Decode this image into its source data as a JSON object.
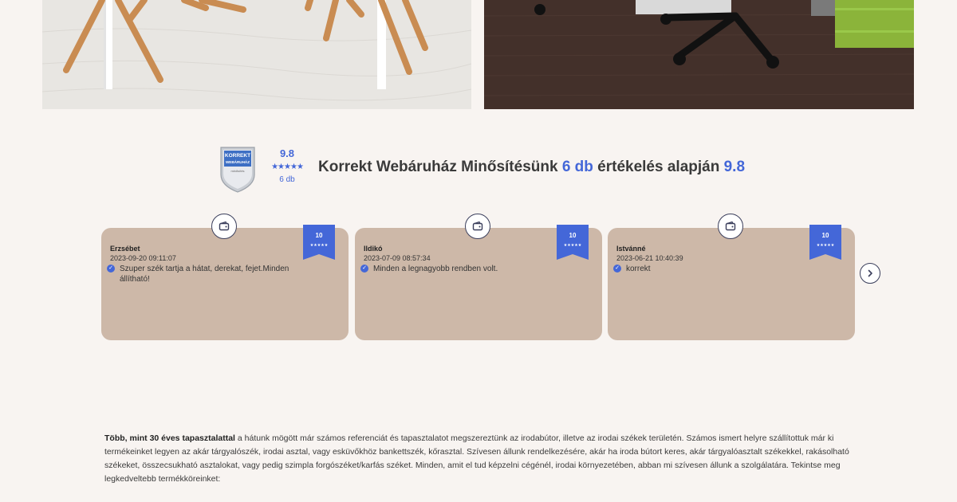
{
  "rating": {
    "badge_line1": "KORREKT",
    "badge_line2": "WEBÁRUHÁZ",
    "badge_line3": "minősítés",
    "score": "9.8",
    "stars": "★★★★★",
    "count": "6 db",
    "title_prefix": "Korrekt Webáruház Minősítésünk ",
    "title_count": "6 db",
    "title_middle": " értékelés alapján ",
    "title_score": "9.8"
  },
  "reviews": [
    {
      "name": "Erzsébet",
      "date": "2023-09-20 09:11:07",
      "text": "Szuper szék tartja a hátat, derekat, fejet.Minden állítható!",
      "score": "10",
      "stars": "★★★★★"
    },
    {
      "name": "Ildikó",
      "date": "2023-07-09 08:57:34",
      "text": "Minden a legnagyobb rendben volt.",
      "score": "10",
      "stars": "★★★★★"
    },
    {
      "name": "Istvánné",
      "date": "2023-06-21 10:40:39",
      "text": "korrekt",
      "score": "10",
      "stars": "★★★★★"
    }
  ],
  "about": {
    "bold": "Több, mint 30 éves tapasztalattal",
    "rest": " a hátunk mögött már számos referenciát és tapasztalatot megszereztünk az irodabútor, illetve az irodai székek területén. Számos ismert helyre szállítottuk már ki termékeinket legyen az akár tárgyalószék, irodai asztal, vagy esküvőkhöz bankettszék, kőrasztal. Szívesen állunk rendelkezésére, akár ha iroda bútort keres, akár tárgyalóasztalt székekkel, rakásolható székeket, összecsukható asztalokat, vagy pedig szimpla forgószéket/karfás széket. Minden, amit el tud képzelni cégénél, irodai környezetében, abban mi szívesen állunk a szolgálatára. Tekintse meg legkedveltebb termékköreinket:"
  },
  "icons": {
    "card_top": "wallet-icon",
    "next": "chevron-right-icon",
    "check": "check-circle-icon"
  },
  "colors": {
    "accent": "#4467d8",
    "card": "#cdb8a8",
    "background": "#f8f4f1"
  }
}
